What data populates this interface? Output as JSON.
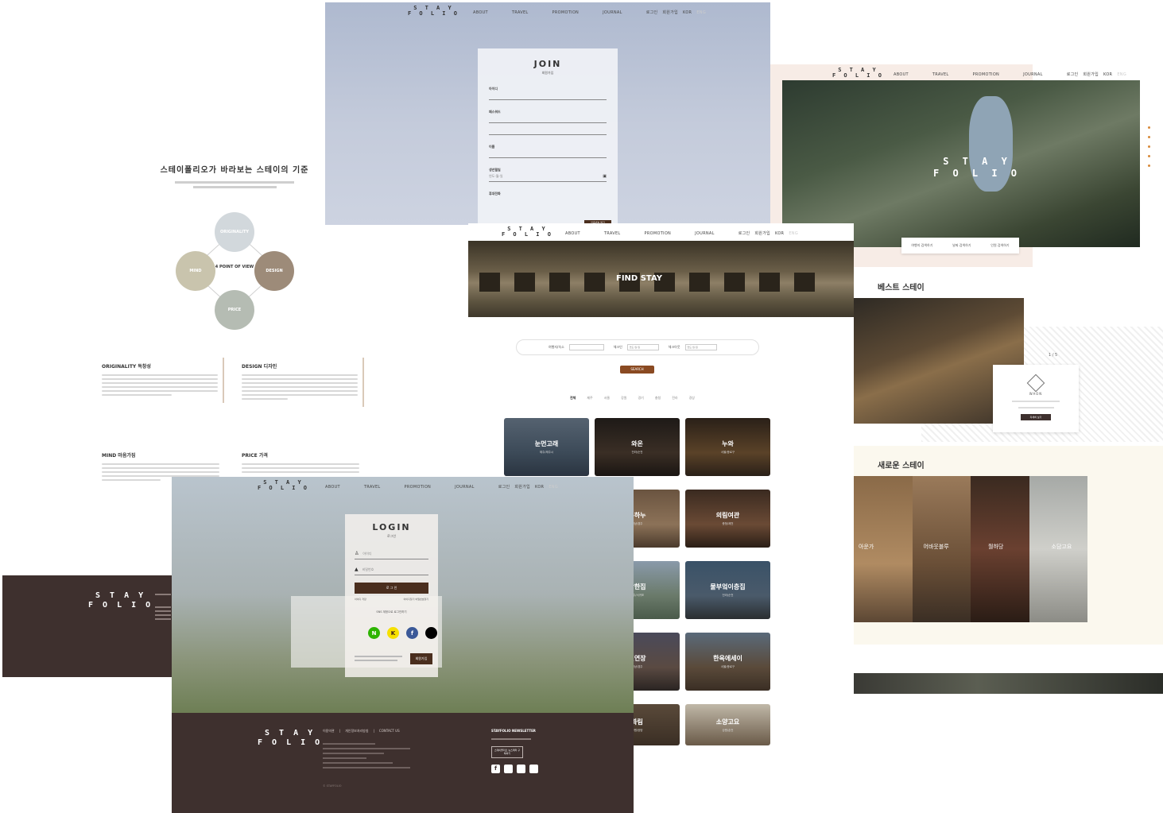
{
  "brand": {
    "logo_line1": "S T A Y",
    "logo_line2": "F O L I O"
  },
  "nav": {
    "about": "ABOUT",
    "travel": "TRAVEL",
    "promotion": "PROMOTION",
    "journal": "JOURNAL",
    "login": "로그인",
    "join": "회원가입",
    "lang_kor": "KOR",
    "lang_eng": "ENG"
  },
  "philosophy": {
    "title": "스테이폴리오가 바라보는 스테이의 기준",
    "center": "4 POINT OF VIEW",
    "originality": "ORIGINALITY",
    "mind": "MIND",
    "design": "DESIGN",
    "price": "PRICE",
    "cards": [
      {
        "title": "ORIGINALITY 독창성"
      },
      {
        "title": "DESIGN 디자인"
      },
      {
        "title": "MIND 마음가짐"
      },
      {
        "title": "PRICE 가격"
      }
    ]
  },
  "join": {
    "title": "JOIN",
    "subtitle": "회원가입",
    "fields": [
      "아이디",
      "패스워드",
      "이름",
      "생년월일",
      "휴대전화"
    ],
    "birth_placeholder": "연도-월-일",
    "phone_button": "인증번호 받기"
  },
  "best": {
    "hero_logo1": "S T A Y",
    "hero_logo2": "F O L I O",
    "search_items": [
      "여행지 검색하기",
      "날짜 검색하기",
      "인원 검색하기"
    ],
    "best_title": "베스트 스테이",
    "new_title": "새로운 스테이",
    "new_stays": [
      "아운가",
      "어바웃블루",
      "월하당",
      "소담고요"
    ],
    "popup_name": "WAON",
    "popup_button": "자세히 보기",
    "pager": "1 / 5"
  },
  "find": {
    "banner": "FIND STAY",
    "search_label": "여행지/숙소",
    "checkin_label": "체크인",
    "checkout_label": "체크아웃",
    "date_placeholder": "연도-월-일",
    "search_button": "SEARCH",
    "filters": [
      "전체",
      "제주",
      "서울",
      "강원",
      "경기",
      "충청",
      "전라",
      "경상"
    ],
    "tiles": [
      {
        "name": "눈먼고래",
        "sub": "제주/제주시"
      },
      {
        "name": "와온",
        "sub": "전라/순천"
      },
      {
        "name": "누와",
        "sub": "서울/종로구"
      },
      {
        "name": "우하누",
        "sub": "경상/경주"
      },
      {
        "name": "의림여관",
        "sub": "충청/제천"
      },
      {
        "name": "담한집",
        "sub": "제주/서귀포"
      },
      {
        "name": "물부엌이층집",
        "sub": "전라/순천"
      },
      {
        "name": "선연장",
        "sub": "경상/경주"
      },
      {
        "name": "한옥에세이",
        "sub": "서울/종로구"
      },
      {
        "name": "화림",
        "sub": "강원/양양"
      },
      {
        "name": "소양고요",
        "sub": "강원/춘천"
      }
    ]
  },
  "login": {
    "title": "LOGIN",
    "subtitle": "로그인",
    "id_placeholder": "아이디",
    "pw_placeholder": "비밀번호",
    "button": "로 그 인",
    "save_id": "아이디 저장",
    "find_id": "아이디찾기",
    "find_pw": "비밀번호찾기",
    "sns": "SNS 계정으로 로그인하기",
    "join_button": "회원가입",
    "social": [
      {
        "label": "N",
        "color": "#2db400"
      },
      {
        "label": "K",
        "color": "#f6e000"
      },
      {
        "label": "f",
        "color": "#3b5998"
      },
      {
        "label": "",
        "color": "#000000"
      }
    ]
  },
  "footer": {
    "links": [
      "이용약관",
      "개인정보처리방침",
      "CONTACT US"
    ],
    "newsletter_title": "STAYFOLIO NEWSLETTER",
    "newsletter_button": "스테이폴리오 뉴스레터 구독하기",
    "copyright": "© STAYFOLIO",
    "email": "stayfolio@stayfolio.com"
  },
  "colors": {
    "brand_brown": "#3e302e",
    "accent_brown": "#4a2e1e",
    "search_orange": "#8a4a22"
  }
}
